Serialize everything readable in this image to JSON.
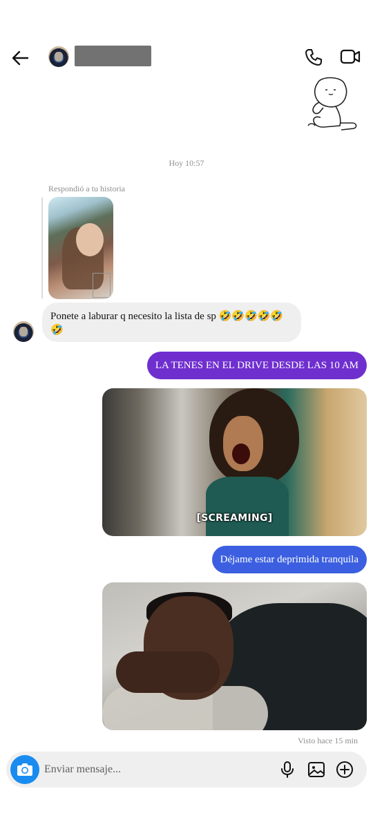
{
  "header": {
    "back_icon": "arrow-left-icon",
    "call_icon": "phone-icon",
    "video_icon": "video-camera-icon"
  },
  "thread": {
    "timestamp": "Hoy 10:57",
    "story_reply_label": "Respondió a tu historia",
    "messages": [
      {
        "direction": "incoming",
        "text": "Ponete a laburar q necesito la lista de sp 🤣🤣🤣🤣🤣🤣"
      },
      {
        "direction": "outgoing",
        "text": "LA TENES EN EL DRIVE DESDE LAS 10 AM",
        "color": "#6f2fcf"
      },
      {
        "direction": "outgoing",
        "type": "gif",
        "caption": "[SCREAMING]"
      },
      {
        "direction": "outgoing",
        "text": "Déjame estar deprimida tranquila",
        "color": "#3b5fe0"
      },
      {
        "direction": "outgoing",
        "type": "gif",
        "caption": ""
      }
    ],
    "seen_status": "Visto hace 15 min"
  },
  "composer": {
    "placeholder": "Enviar mensaje...",
    "camera_icon": "camera-icon",
    "mic_icon": "microphone-icon",
    "gallery_icon": "image-icon",
    "plus_icon": "plus-circle-icon",
    "camera_color": "#1a8cf0"
  }
}
